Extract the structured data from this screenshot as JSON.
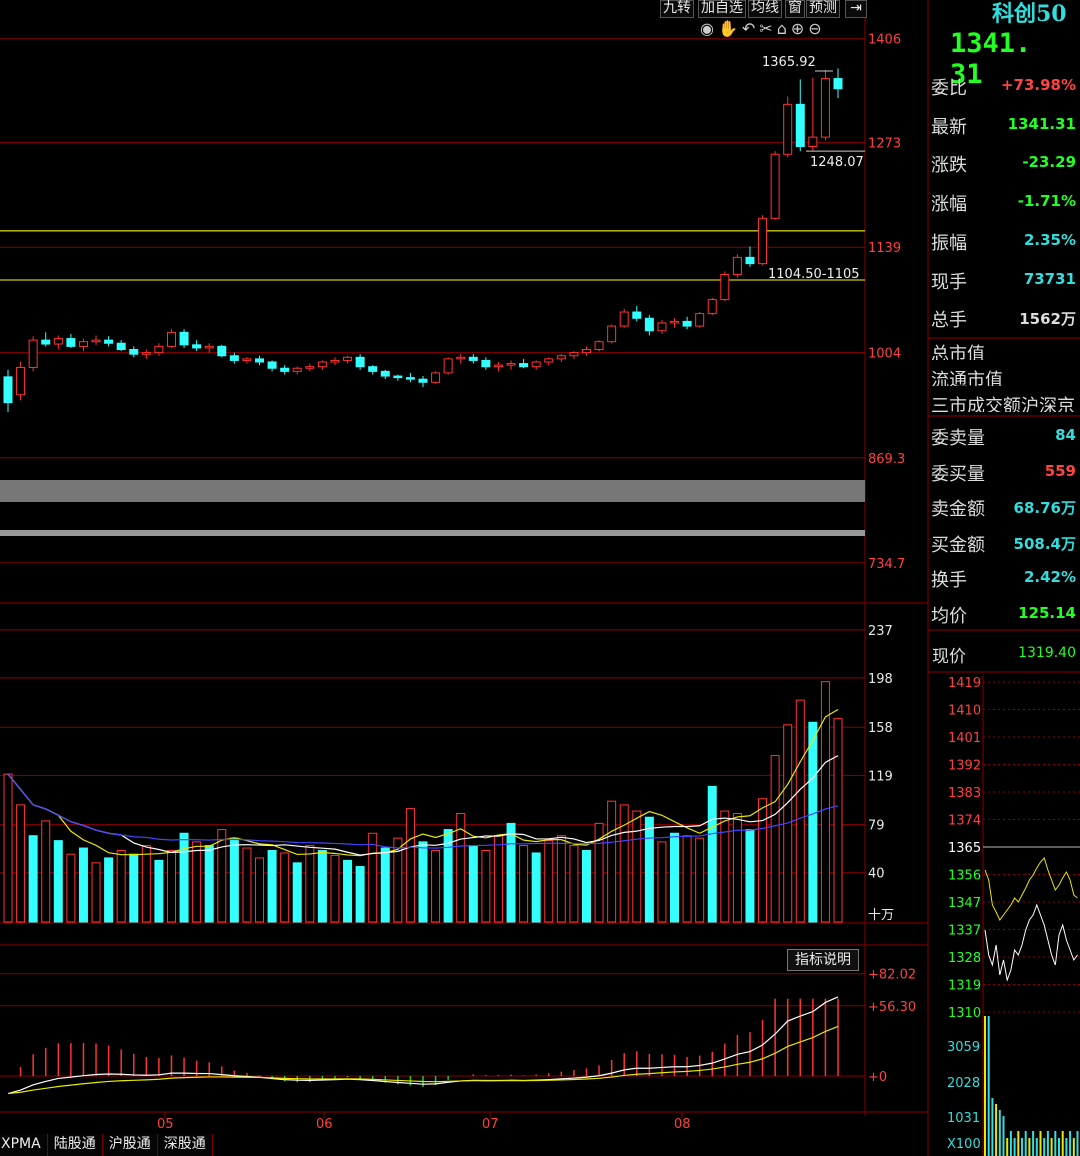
{
  "toolbar": {
    "buttons": [
      "九转",
      "加自选",
      "均线",
      "窗",
      "预测"
    ],
    "corner_icon": "arrow-right-bar-icon",
    "tools": [
      "eye-icon",
      "hand-icon",
      "undo-icon",
      "scissors-icon",
      "lock-icon",
      "zoom-in-icon",
      "zoom-out-icon"
    ]
  },
  "colors": {
    "up": "#ff3333",
    "down": "#33ffff",
    "grid": "#8b0000",
    "level": "#c8c800",
    "bg": "#000000"
  },
  "quote": {
    "name": "科创50",
    "price": "1341. 31",
    "rows": [
      {
        "label": "委比",
        "value": "+73.98%",
        "color": "#ff4444"
      },
      {
        "label": "最新",
        "value": "1341.31",
        "color": "#22ff22"
      },
      {
        "label": "涨跌",
        "value": "-23.29",
        "color": "#22ff22"
      },
      {
        "label": "涨幅",
        "value": "-1.71%",
        "color": "#22ff22"
      },
      {
        "label": "振幅",
        "value": "2.35%",
        "color": "#33dddd"
      },
      {
        "label": "现手",
        "value": "73731",
        "color": "#33dddd"
      },
      {
        "label": "总手",
        "value": "1562万",
        "color": "#dddddd"
      }
    ],
    "plain_rows": [
      "总市值",
      "流通市值",
      "三市成交额沪深京"
    ],
    "rows2": [
      {
        "label": "委卖量",
        "value": "84",
        "color": "#33dddd"
      },
      {
        "label": "委买量",
        "value": "559",
        "color": "#ff4444"
      },
      {
        "label": "卖金额",
        "value": "68.76万",
        "color": "#33dddd"
      },
      {
        "label": "买金额",
        "value": "508.4万",
        "color": "#33dddd"
      },
      {
        "label": "换手",
        "value": "2.42%",
        "color": "#33dddd"
      },
      {
        "label": "均价",
        "value": "125.14",
        "color": "#22ff22"
      }
    ],
    "now_label": "现价",
    "now_value": "1319.40"
  },
  "intraday": {
    "price_ticks": [
      "1419",
      "1410",
      "1401",
      "1392",
      "1383",
      "1374",
      "1365",
      "1356",
      "1347",
      "1337",
      "1328",
      "1319",
      "1310"
    ],
    "vol_ticks": [
      "3059",
      "2028",
      "1031",
      "X100"
    ]
  },
  "tabs": [
    "XPMA",
    "陆股通",
    "沪股通",
    "深股通"
  ],
  "indicator_button": "指标说明",
  "chart_data": [
    {
      "type": "candlestick",
      "y_ticks": [
        "1406",
        "1273",
        "1139",
        "1004",
        "869.3",
        "734.7"
      ],
      "ylim": [
        700,
        1430
      ],
      "x_ticks": [
        "05",
        "06",
        "07",
        "08"
      ],
      "annotations": [
        "1365.92",
        "1248.07",
        "1104.50-1105"
      ],
      "levels": [
        1160,
        1097
      ],
      "ohlc": [
        [
          973,
          982,
          928,
          940
        ],
        [
          950,
          992,
          943,
          985
        ],
        [
          985,
          1025,
          980,
          1020
        ],
        [
          1020,
          1030,
          1012,
          1015
        ],
        [
          1015,
          1026,
          1008,
          1022
        ],
        [
          1022,
          1028,
          1010,
          1012
        ],
        [
          1012,
          1022,
          1006,
          1018
        ],
        [
          1018,
          1026,
          1014,
          1020
        ],
        [
          1020,
          1025,
          1012,
          1016
        ],
        [
          1016,
          1020,
          1006,
          1008
        ],
        [
          1008,
          1012,
          998,
          1002
        ],
        [
          1002,
          1008,
          996,
          1004
        ],
        [
          1004,
          1016,
          1000,
          1012
        ],
        [
          1012,
          1034,
          1010,
          1030
        ],
        [
          1030,
          1034,
          1010,
          1014
        ],
        [
          1014,
          1020,
          1006,
          1010
        ],
        [
          1010,
          1016,
          1004,
          1012
        ],
        [
          1012,
          1014,
          998,
          1000
        ],
        [
          1000,
          1004,
          990,
          994
        ],
        [
          994,
          998,
          990,
          996
        ],
        [
          996,
          1000,
          988,
          992
        ],
        [
          992,
          994,
          980,
          984
        ],
        [
          984,
          988,
          976,
          980
        ],
        [
          980,
          986,
          976,
          984
        ],
        [
          984,
          990,
          980,
          986
        ],
        [
          986,
          994,
          982,
          992
        ],
        [
          992,
          998,
          988,
          994
        ],
        [
          994,
          1000,
          990,
          998
        ],
        [
          998,
          1002,
          982,
          986
        ],
        [
          986,
          988,
          976,
          980
        ],
        [
          980,
          982,
          970,
          974
        ],
        [
          974,
          976,
          968,
          972
        ],
        [
          972,
          978,
          966,
          970
        ],
        [
          970,
          974,
          960,
          966
        ],
        [
          966,
          980,
          964,
          978
        ],
        [
          978,
          998,
          976,
          996
        ],
        [
          996,
          1002,
          990,
          998
        ],
        [
          998,
          1002,
          990,
          994
        ],
        [
          994,
          998,
          982,
          986
        ],
        [
          986,
          992,
          980,
          988
        ],
        [
          988,
          994,
          982,
          990
        ],
        [
          990,
          996,
          984,
          986
        ],
        [
          986,
          994,
          982,
          992
        ],
        [
          992,
          998,
          988,
          996
        ],
        [
          996,
          1002,
          992,
          1000
        ],
        [
          1000,
          1006,
          996,
          1004
        ],
        [
          1004,
          1012,
          1000,
          1008
        ],
        [
          1008,
          1020,
          1006,
          1018
        ],
        [
          1018,
          1040,
          1016,
          1038
        ],
        [
          1038,
          1060,
          1036,
          1056
        ],
        [
          1056,
          1064,
          1044,
          1048
        ],
        [
          1048,
          1052,
          1026,
          1032
        ],
        [
          1032,
          1046,
          1028,
          1042
        ],
        [
          1042,
          1048,
          1036,
          1044
        ],
        [
          1044,
          1050,
          1034,
          1038
        ],
        [
          1038,
          1056,
          1036,
          1054
        ],
        [
          1054,
          1074,
          1052,
          1072
        ],
        [
          1072,
          1108,
          1070,
          1104
        ],
        [
          1104,
          1130,
          1100,
          1126
        ],
        [
          1126,
          1140,
          1114,
          1118
        ],
        [
          1118,
          1180,
          1116,
          1176
        ],
        [
          1176,
          1262,
          1174,
          1258
        ],
        [
          1258,
          1332,
          1254,
          1322
        ],
        [
          1322,
          1354,
          1262,
          1268
        ],
        [
          1268,
          1356,
          1262,
          1280
        ],
        [
          1280,
          1366,
          1276,
          1355
        ],
        [
          1355,
          1368,
          1330,
          1342
        ]
      ]
    },
    {
      "type": "bar",
      "ylabel": "十万",
      "y_ticks": [
        "237",
        "198",
        "158",
        "119",
        "79",
        "40"
      ],
      "ylim": [
        0,
        245
      ],
      "values": [
        120,
        95,
        70,
        82,
        66,
        55,
        60,
        48,
        52,
        58,
        55,
        62,
        50,
        58,
        72,
        65,
        62,
        75,
        68,
        60,
        52,
        58,
        56,
        48,
        62,
        58,
        54,
        50,
        45,
        72,
        60,
        68,
        92,
        65,
        58,
        75,
        88,
        62,
        58,
        70,
        80,
        62,
        56,
        66,
        70,
        62,
        58,
        80,
        98,
        95,
        90,
        85,
        65,
        72,
        70,
        68,
        110,
        90,
        88,
        75,
        100,
        135,
        160,
        180,
        162,
        195,
        165
      ],
      "up": [
        true,
        true,
        false,
        true,
        false,
        true,
        false,
        true,
        false,
        true,
        false,
        true,
        false,
        true,
        false,
        true,
        false,
        true,
        false,
        true,
        true,
        false,
        true,
        false,
        true,
        false,
        true,
        false,
        false,
        true,
        false,
        true,
        true,
        false,
        true,
        false,
        true,
        false,
        true,
        true,
        false,
        true,
        false,
        true,
        true,
        true,
        false,
        true,
        true,
        true,
        true,
        false,
        true,
        false,
        true,
        true,
        false,
        true,
        true,
        false,
        true,
        true,
        true,
        true,
        false,
        true,
        true
      ]
    },
    {
      "type": "bar",
      "name": "XPMA",
      "y_ticks": [
        "+82.02",
        "+56.30",
        "+0"
      ],
      "ylim": [
        -20,
        85
      ]
    }
  ]
}
